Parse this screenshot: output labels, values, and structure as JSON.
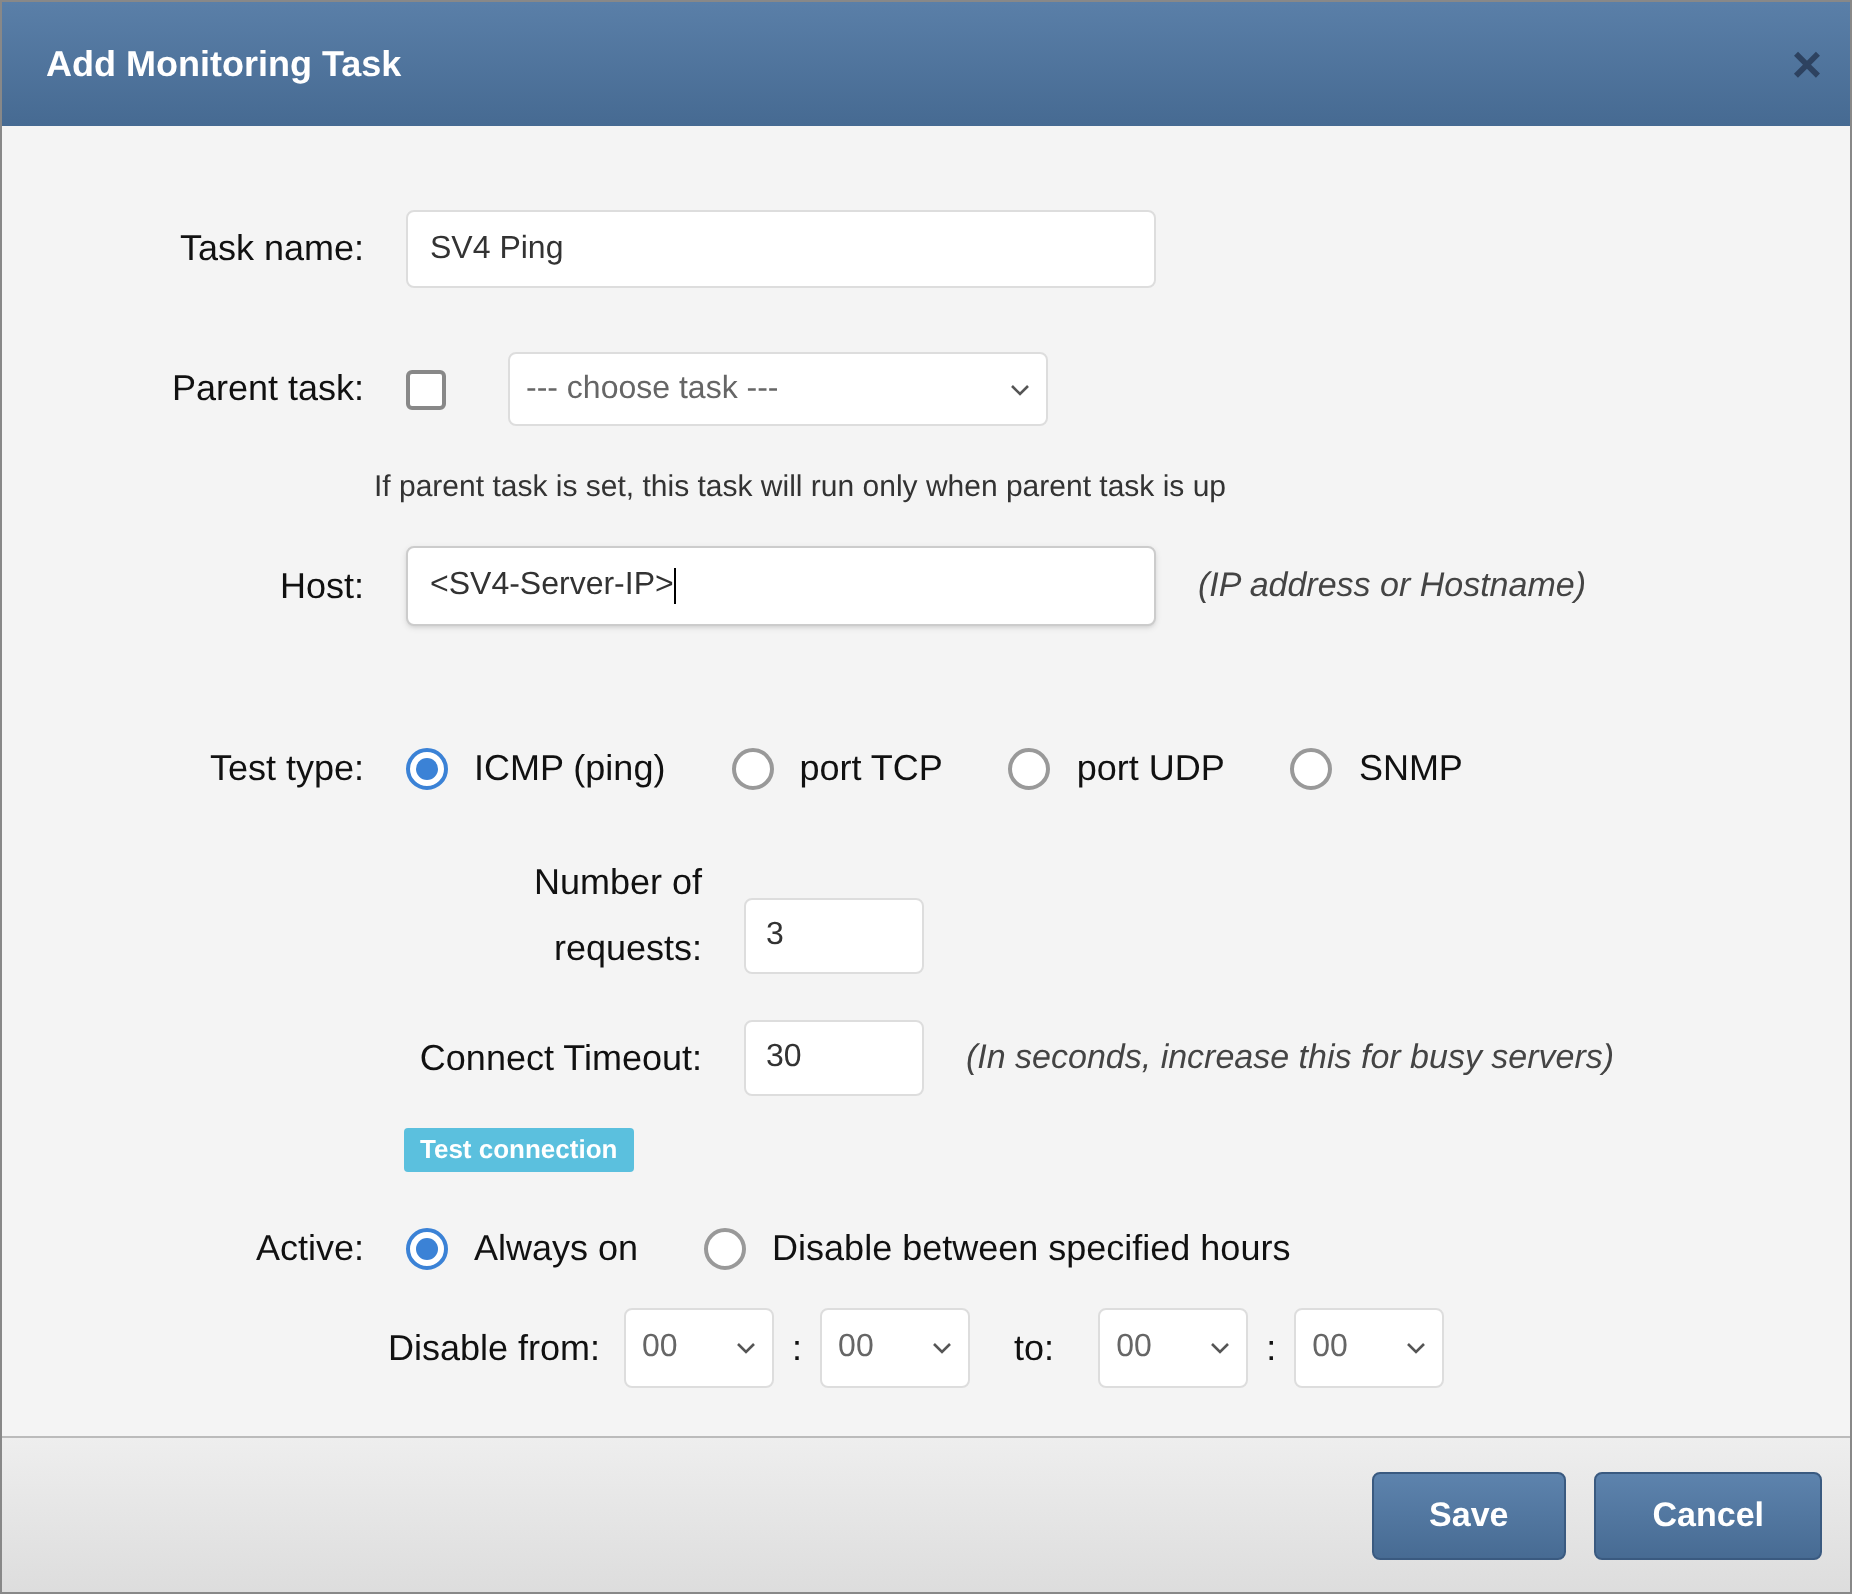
{
  "dialog": {
    "title": "Add Monitoring Task",
    "close": "×"
  },
  "task_name": {
    "label": "Task name:",
    "value": "SV4 Ping"
  },
  "parent_task": {
    "label": "Parent task:",
    "checked": false,
    "select": "--- choose task ---",
    "hint": "If parent task is set, this task will run only when parent task is up"
  },
  "host": {
    "label": "Host:",
    "value": "<SV4-Server-IP>",
    "note": "(IP address or Hostname)"
  },
  "test_type": {
    "label": "Test type:",
    "options": [
      {
        "label": "ICMP (ping)",
        "selected": true
      },
      {
        "label": "port TCP",
        "selected": false
      },
      {
        "label": "port UDP",
        "selected": false
      },
      {
        "label": "SNMP",
        "selected": false
      }
    ]
  },
  "requests": {
    "label": "Number of requests:",
    "value": "3"
  },
  "timeout": {
    "label": "Connect Timeout:",
    "value": "30",
    "note": "(In seconds, increase this for busy servers)"
  },
  "test_button": "Test connection",
  "active": {
    "label": "Active:",
    "options": [
      {
        "label": "Always on",
        "selected": true
      },
      {
        "label": "Disable between specified hours",
        "selected": false
      }
    ]
  },
  "disable": {
    "label": "Disable from:",
    "from_hour": "00",
    "sep1": ":",
    "from_min": "00",
    "to_label": "to:",
    "to_hour": "00",
    "sep2": ":",
    "to_min": "00"
  },
  "buttons": [
    "Save",
    "Cancel"
  ]
}
